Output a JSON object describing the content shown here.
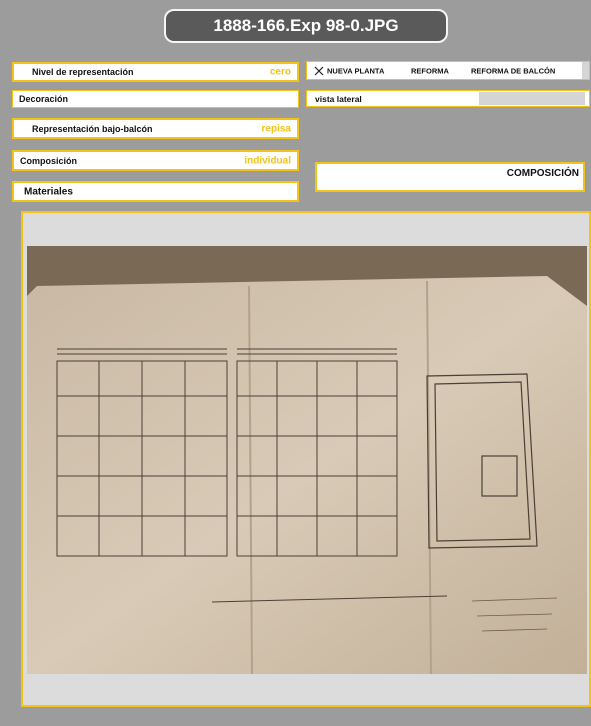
{
  "header": {
    "title": "1888-166.Exp 98-0.JPG"
  },
  "fields": {
    "nivel": {
      "label": "Nivel de representación",
      "value": "cero"
    },
    "decoracion": {
      "label": "Decoración",
      "value": ""
    },
    "bajo_balcon": {
      "label": "Representación bajo-balcón",
      "value": "repisa"
    },
    "composicion": {
      "label": "Composición",
      "value": "individual"
    },
    "materiales": {
      "label": "Materiales",
      "value": ""
    }
  },
  "tabs": {
    "nueva_planta": "NUEVA PLANTA",
    "reforma": "REFORMA",
    "reforma_balcon": "REFORMA DE  BALCÓN"
  },
  "vista": {
    "label": "vista lateral"
  },
  "composicion_panel": {
    "label": "COMPOSICIÓN"
  },
  "colors": {
    "accent": "#f3c21b",
    "background": "#9c9c9c",
    "title_bg": "#5a5a5a"
  },
  "icons": {
    "selected_mark": "x-icon"
  }
}
